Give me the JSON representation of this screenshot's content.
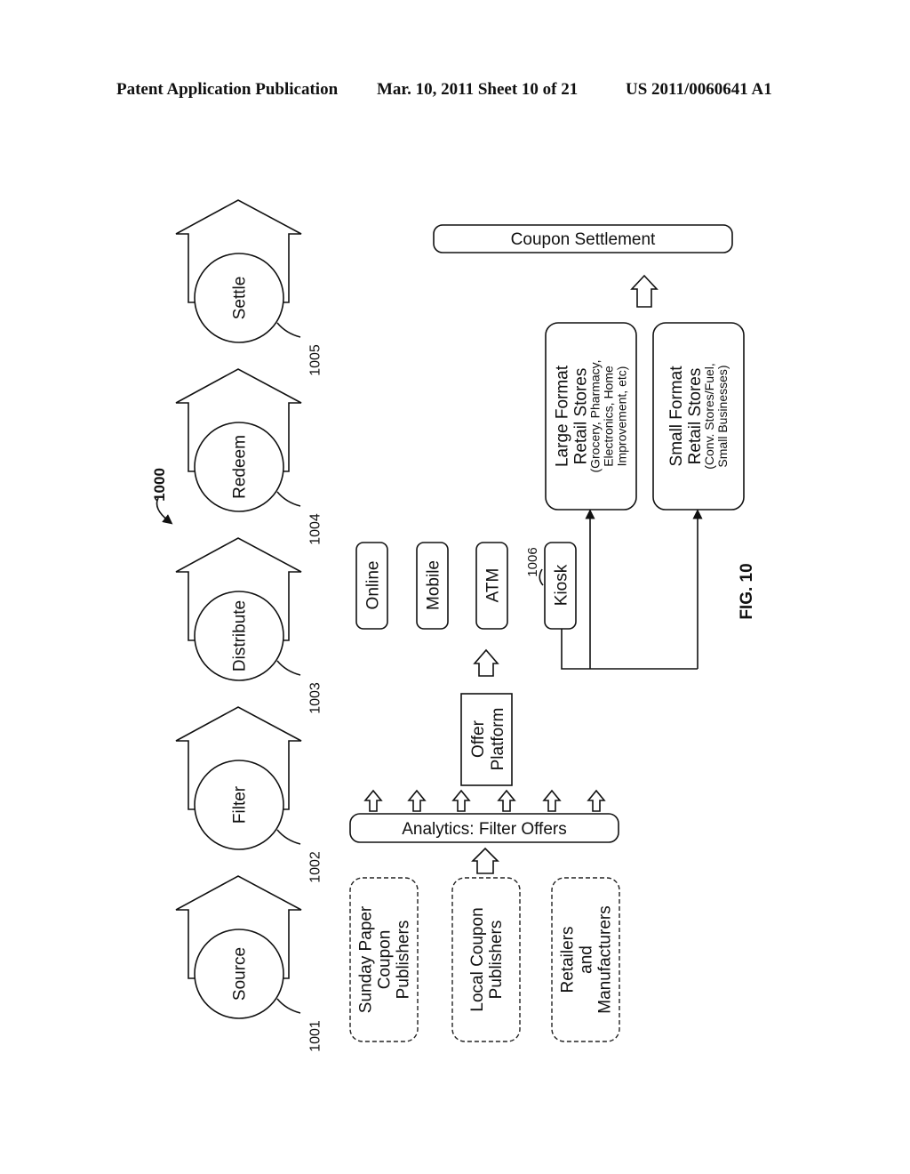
{
  "header": {
    "publication": "Patent Application Publication",
    "date_sheet": "Mar. 10, 2011  Sheet 10 of 21",
    "patent_number": "US 2011/0060641 A1"
  },
  "figure": {
    "label": "FIG. 10",
    "reference": "1000"
  },
  "stages": [
    {
      "label": "Source",
      "ref": "1001"
    },
    {
      "label": "Filter",
      "ref": "1002"
    },
    {
      "label": "Distribute",
      "ref": "1003"
    },
    {
      "label": "Redeem",
      "ref": "1004"
    },
    {
      "label": "Settle",
      "ref": "1005"
    }
  ],
  "sources": [
    {
      "lines": [
        "Sunday Paper",
        "Coupon",
        "Publishers"
      ]
    },
    {
      "lines": [
        "Local Coupon",
        "Publishers"
      ]
    },
    {
      "lines": [
        "Retailers",
        "and",
        "Manufacturers"
      ]
    }
  ],
  "analytics": {
    "label": "Analytics: Filter Offers"
  },
  "offer_platform": {
    "lines": [
      "Offer",
      "Platform"
    ]
  },
  "channels": [
    {
      "label": "Online"
    },
    {
      "label": "Mobile"
    },
    {
      "label": "ATM"
    },
    {
      "label": "Kiosk",
      "ref": "1006"
    }
  ],
  "stores": [
    {
      "title": [
        "Large Format",
        "Retail Stores"
      ],
      "detail": [
        "(Grocery, Pharmacy,",
        "Electronics, Home",
        "Improvement, etc)"
      ]
    },
    {
      "title": [
        "Small Format",
        "Retail Stores"
      ],
      "detail": [
        "(Conv. Stores/Fuel,",
        "Small Businesses)"
      ]
    }
  ],
  "settlement": {
    "label": "Coupon Settlement"
  }
}
